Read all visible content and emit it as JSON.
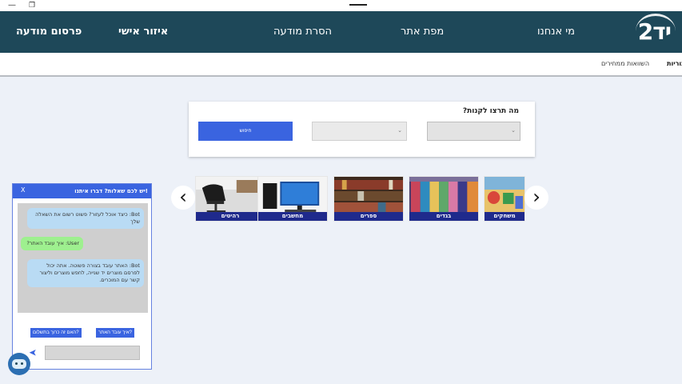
{
  "header": {
    "logo_text": "יד2",
    "nav": {
      "about": "מי אנחנו",
      "sitemap": "מפת אתר",
      "remove_ad": "הסרת מודעה",
      "personal_area": "איזור אישי",
      "publish_ad": "פרסום מודעה"
    }
  },
  "subnav": {
    "categories": "קטגוריות",
    "price_compare": "השוואות ממחירים"
  },
  "search": {
    "title": "מה תרצו לקנות?",
    "select1_value": "",
    "select2_value": "",
    "button_label": "חיפוש"
  },
  "carousel": {
    "categories": [
      {
        "label": "משחקים",
        "icon": "toys-photo"
      },
      {
        "label": "בגדים",
        "icon": "clothes-photo"
      },
      {
        "label": "ספרים",
        "icon": "books-photo"
      },
      {
        "label": "מחשבים",
        "icon": "computer-photo"
      },
      {
        "label": "רהיטים",
        "icon": "furniture-photo"
      }
    ]
  },
  "chat": {
    "title": "יש לכם שאלות? דברו איתנו!",
    "close": "X",
    "messages": [
      {
        "role": "bot",
        "text": "Bot: כיצד אוכל לעזור? פשוט רשום את השאלה שלך"
      },
      {
        "role": "user",
        "text": "User: איך עובד האתר?"
      },
      {
        "role": "bot",
        "text": "Bot: האתר עובד בצורה פשוטה. אתה יכול לפרסם מוצרים יד שנייה, לחפש מוצרים וליצור קשר עם המוכרים."
      }
    ],
    "quick_replies": [
      "איך עובד האתר?",
      "האם זה כרוך בתשלום?"
    ],
    "input_value": ""
  },
  "colors": {
    "header_bg": "#1e4859",
    "accent": "#3a64e0",
    "category_label_bg": "#1f2a8c",
    "page_bg": "#edf1f8"
  }
}
